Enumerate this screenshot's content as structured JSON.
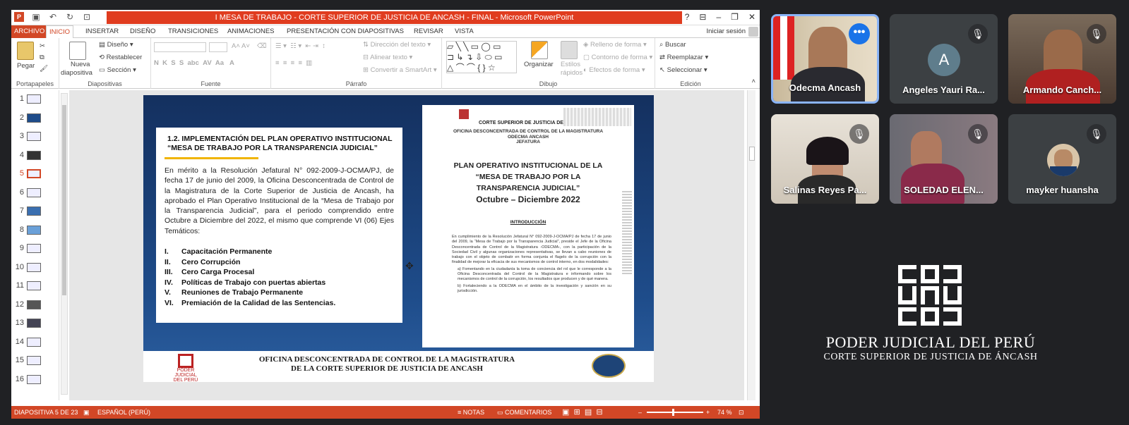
{
  "window": {
    "title": "I MESA DE TRABAJO - CORTE SUPERIOR DE JUSTICIA DE ANCASH - FINAL - Microsoft PowerPoint"
  },
  "tabs": [
    "ARCHIVO",
    "INICIO",
    "INSERTAR",
    "DISEÑO",
    "TRANSICIONES",
    "ANIMACIONES",
    "PRESENTACIÓN CON DIAPOSITIVAS",
    "REVISAR",
    "VISTA"
  ],
  "signin": "Iniciar sesión",
  "ribbon": {
    "paste": "Pegar",
    "new_slide_1": "Nueva",
    "new_slide_2": "diapositiva",
    "layout": "Diseño",
    "reset": "Restablecer",
    "section": "Sección",
    "text_direction": "Dirección del texto",
    "align_text": "Alinear texto",
    "smartart": "Convertir a SmartArt",
    "arrange": "Organizar",
    "quick_styles_1": "Estilos",
    "quick_styles_2": "rápidos",
    "shape_fill": "Relleno de forma",
    "shape_outline": "Contorno de forma",
    "shape_effects": "Efectos de forma",
    "find": "Buscar",
    "replace": "Reemplazar",
    "select": "Seleccionar",
    "groups": {
      "clipboard": "Portapapeles",
      "slides": "Diapositivas",
      "font": "Fuente",
      "paragraph": "Párrafo",
      "drawing": "Dibujo",
      "editing": "Edición"
    }
  },
  "thumbnails": [
    "1",
    "2",
    "3",
    "4",
    "5",
    "6",
    "7",
    "8",
    "9",
    "10",
    "11",
    "12",
    "13",
    "14",
    "15",
    "16"
  ],
  "slide": {
    "heading_1": "1.2. IMPLEMENTACIÓN DEL PLAN OPERATIVO INSTITUCIONAL",
    "heading_2": "“MESA DE TRABAJO POR LA TRANSPARENCIA JUDICIAL”",
    "body": "En mérito a la Resolución Jefatural N° 092-2009-J-OCMA/PJ, de fecha 17 de junio del 2009, la Oficina Desconcentrada de Control de la Magistratura  de la Corte Superior de Justicia de Ancash, ha aprobado el Plan Operativo Institucional de la “Mesa de Trabajo por la Transparencia Judicial”, para el periodo comprendido entre Octubre a Diciembre del 2022, el mismo que comprende VI (06) Ejes Temáticos:",
    "list": [
      {
        "num": "I.",
        "text": "Capacitación Permanente"
      },
      {
        "num": "II.",
        "text": "Cero Corrupción"
      },
      {
        "num": "III.",
        "text": "Cero Carga Procesal"
      },
      {
        "num": "IV.",
        "text": "Políticas de Trabajo con puertas abiertas"
      },
      {
        "num": "V.",
        "text": "Reuniones de Trabajo Permanente"
      },
      {
        "num": "VI.",
        "text": "Premiación de la Calidad de las Sentencias."
      }
    ],
    "footer_1": "OFICINA DESCONCENTRADA DE CONTROL DE LA MAGISTRATURA",
    "footer_2": "DE LA CORTE SUPERIOR DE JUSTICIA DE ANCASH",
    "footer_logo_text": "PODER JUDICIAL DEL PERÚ"
  },
  "document": {
    "org_1": "CORTE SUPERIOR DE JUSTICIA DE",
    "org_2": "OFICINA DESCONCENTRADA DE CONTROL DE LA MAGISTRATURA",
    "org_3": "ODECMA ANCASH",
    "org_4": "JEFATURA",
    "title_1": "PLAN OPERATIVO INSTITUCIONAL DE LA",
    "title_2": "“MESA DE TRABAJO POR LA",
    "title_3": "TRANSPARENCIA JUDICIAL”",
    "title_4": "Octubre – Diciembre 2022",
    "intro": "INTRODUCCIÓN",
    "body": "En cumplimiento de la Resolución Jefatural N° 092-2009-J-OCMA/PJ de fecha 17 de junio del 2009, la “Mesa de Trabajo por la Transparencia Judicial”, preside el Jefe de la Oficina Desconcentrada de Control de la Magistratura -ODECMA-, con la participación de la Sociedad Civil y algunas organizaciones representativas, se llevan a cabo reuniones de trabajo con el objeto de combatir en forma conjunta el flagelo de la corrupción con la finalidad de mejorar la eficacia de sus mecanismos de control interno, en dos modalidades:",
    "item_a": "a) Fomentando en la ciudadanía la toma de conciencia del rol que le corresponde a la Oficina Desconcentrada del Control de la Magistratura e informando sobre los mecanismos de control de la corrupción, los resultados que producen y de qué manera.",
    "item_b": "b) Fortaleciendo a la ODECMA en el ámbito de la investigación y sanción en su jurisdicción."
  },
  "status": {
    "slide_count": "DIAPOSITIVA 5 DE 23",
    "language": "ESPAÑOL (PERÚ)",
    "notes": "NOTAS",
    "comments": "COMENTARIOS",
    "zoom": "74 %"
  },
  "participants": [
    {
      "name": "Odecma Ancash"
    },
    {
      "name": "Angeles Yauri Ra...",
      "initial": "A"
    },
    {
      "name": "Armando Canch..."
    },
    {
      "name": "Salinas Reyes Pa..."
    },
    {
      "name": "SOLEDAD ELEN..."
    },
    {
      "name": "mayker huansha"
    }
  ],
  "brand": {
    "title": "PODER JUDICIAL DEL PERÚ",
    "subtitle": "CORTE SUPERIOR DE JUSTICIA DE ÁNCASH"
  },
  "colors": {
    "accent": "#d24726",
    "title_strip": "#e03c1f",
    "meet_bg": "#202124",
    "active_tile": "#8ab4f8"
  }
}
